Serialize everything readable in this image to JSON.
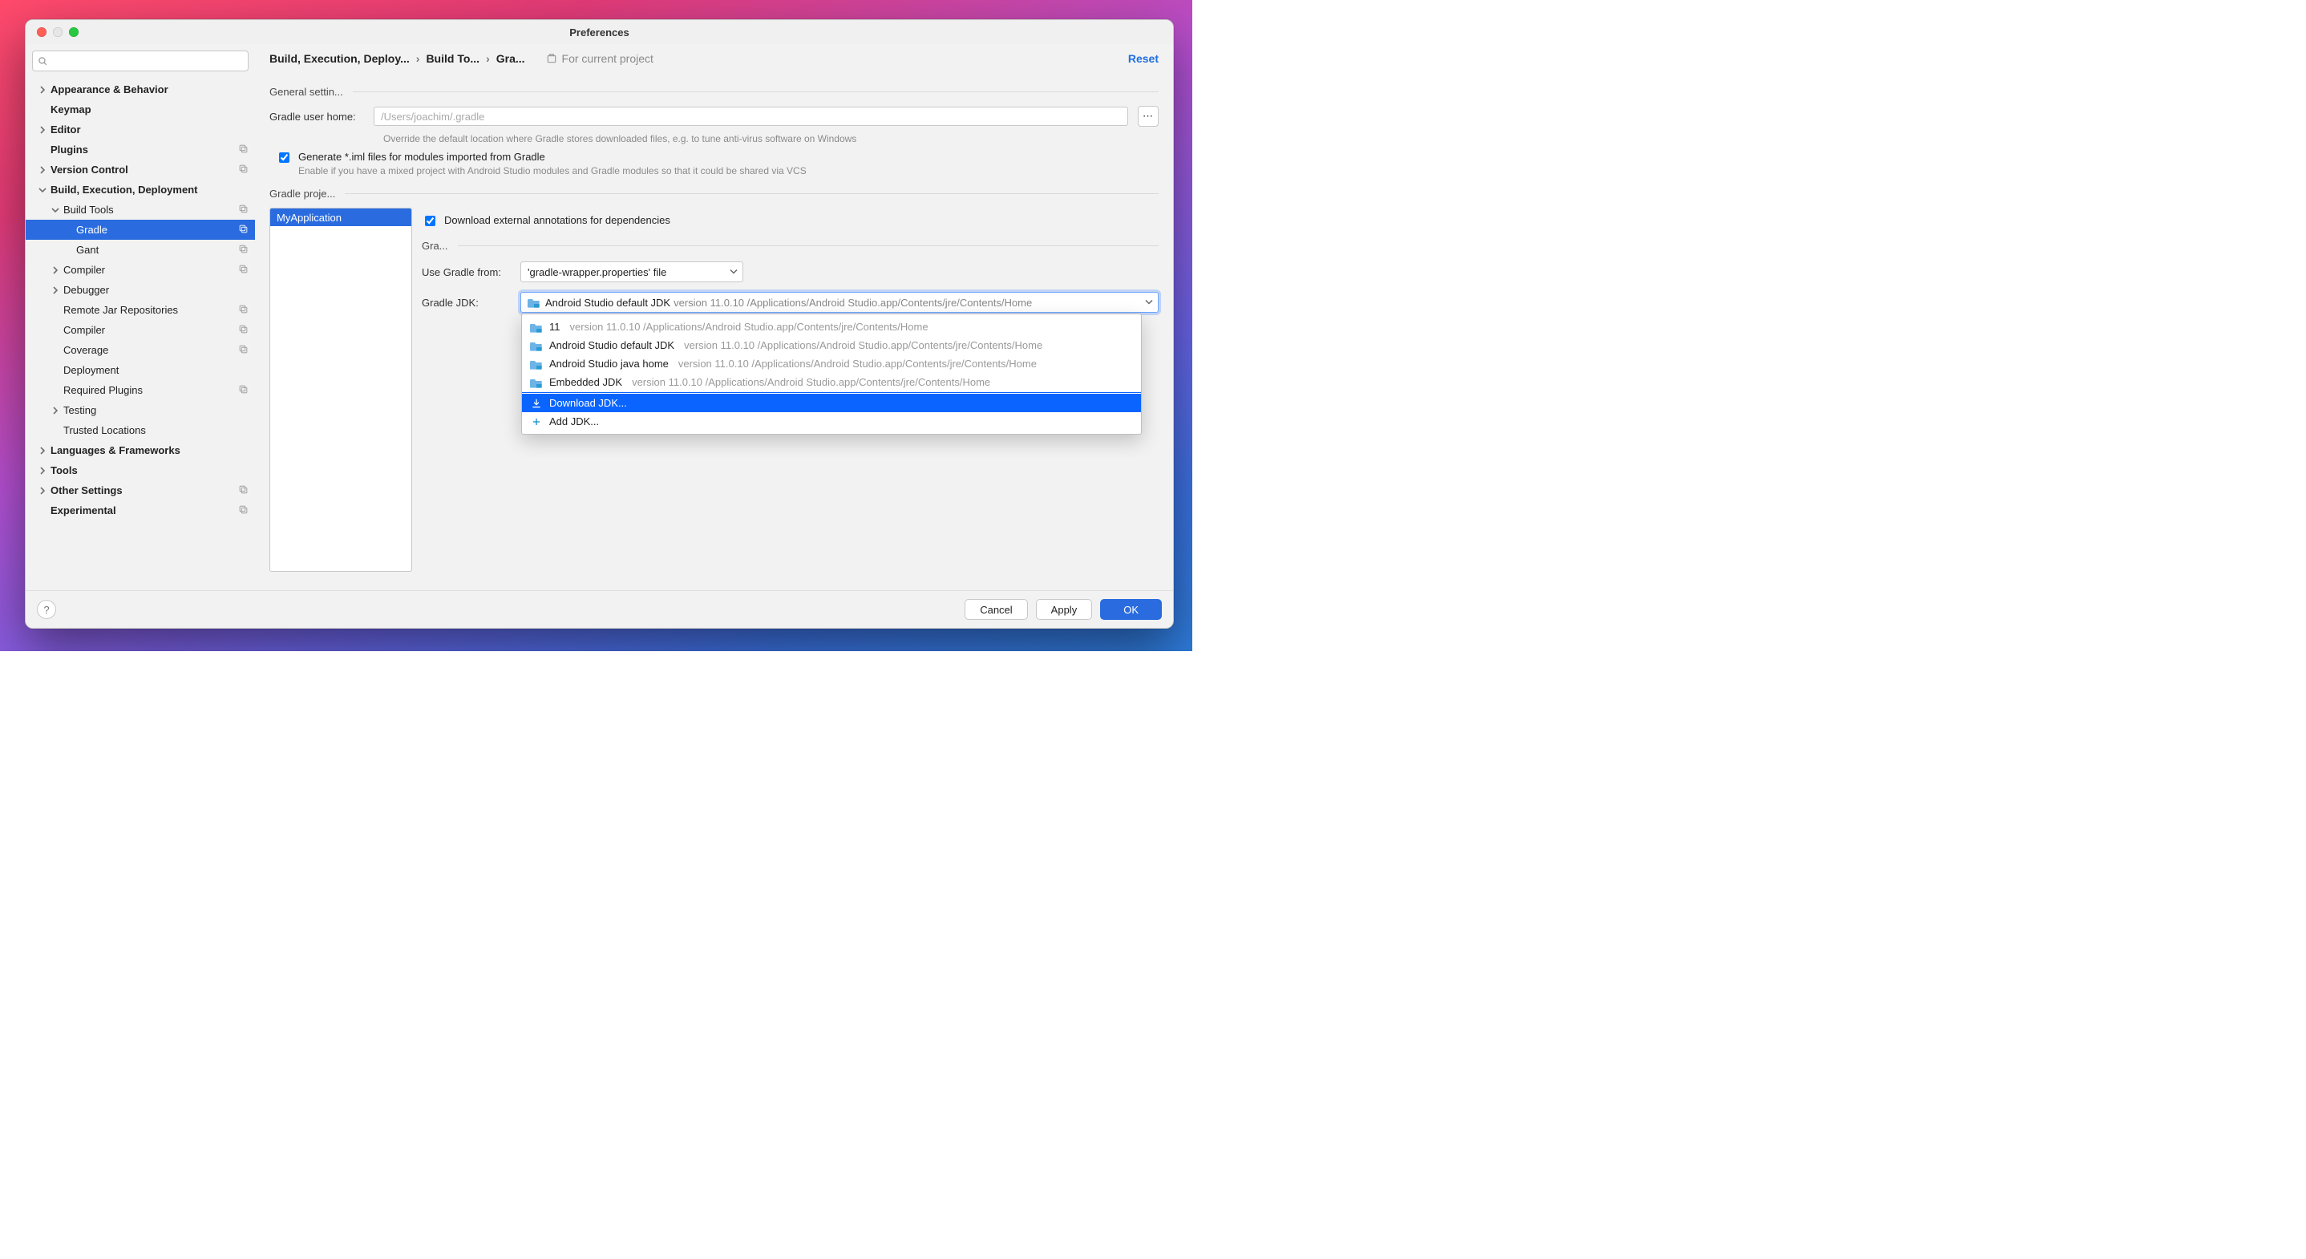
{
  "window": {
    "title": "Preferences"
  },
  "breadcrumb": {
    "c1": "Build, Execution, Deploy...",
    "c2": "Build To...",
    "c3": "Gra...",
    "scope": "For current project",
    "reset": "Reset"
  },
  "sidebar": {
    "items": [
      {
        "label": "Appearance & Behavior",
        "bold": true,
        "chev": "right",
        "indent": 0,
        "copy": false
      },
      {
        "label": "Keymap",
        "bold": true,
        "chev": "none",
        "indent": 0,
        "copy": false
      },
      {
        "label": "Editor",
        "bold": true,
        "chev": "right",
        "indent": 0,
        "copy": false
      },
      {
        "label": "Plugins",
        "bold": true,
        "chev": "none",
        "indent": 0,
        "copy": true
      },
      {
        "label": "Version Control",
        "bold": true,
        "chev": "right",
        "indent": 0,
        "copy": true
      },
      {
        "label": "Build, Execution, Deployment",
        "bold": true,
        "chev": "down",
        "indent": 0,
        "copy": false
      },
      {
        "label": "Build Tools",
        "bold": false,
        "chev": "down",
        "indent": 1,
        "copy": true
      },
      {
        "label": "Gradle",
        "bold": false,
        "chev": "none",
        "indent": 2,
        "copy": true,
        "selected": true
      },
      {
        "label": "Gant",
        "bold": false,
        "chev": "none",
        "indent": 2,
        "copy": true
      },
      {
        "label": "Compiler",
        "bold": false,
        "chev": "right",
        "indent": 1,
        "copy": true
      },
      {
        "label": "Debugger",
        "bold": false,
        "chev": "right",
        "indent": 1,
        "copy": false
      },
      {
        "label": "Remote Jar Repositories",
        "bold": false,
        "chev": "none",
        "indent": 1,
        "copy": true
      },
      {
        "label": "Compiler",
        "bold": false,
        "chev": "none",
        "indent": 1,
        "copy": true
      },
      {
        "label": "Coverage",
        "bold": false,
        "chev": "none",
        "indent": 1,
        "copy": true
      },
      {
        "label": "Deployment",
        "bold": false,
        "chev": "none",
        "indent": 1,
        "copy": false
      },
      {
        "label": "Required Plugins",
        "bold": false,
        "chev": "none",
        "indent": 1,
        "copy": true
      },
      {
        "label": "Testing",
        "bold": false,
        "chev": "right",
        "indent": 1,
        "copy": false
      },
      {
        "label": "Trusted Locations",
        "bold": false,
        "chev": "none",
        "indent": 1,
        "copy": false
      },
      {
        "label": "Languages & Frameworks",
        "bold": true,
        "chev": "right",
        "indent": 0,
        "copy": false
      },
      {
        "label": "Tools",
        "bold": true,
        "chev": "right",
        "indent": 0,
        "copy": false
      },
      {
        "label": "Other Settings",
        "bold": true,
        "chev": "right",
        "indent": 0,
        "copy": true
      },
      {
        "label": "Experimental",
        "bold": true,
        "chev": "none",
        "indent": 0,
        "copy": true
      }
    ]
  },
  "general": {
    "title": "General settin...",
    "userHomeLabel": "Gradle user home:",
    "userHomePlaceholder": "/Users/joachim/.gradle",
    "userHomeHelp": "Override the default location where Gradle stores downloaded files, e.g. to tune anti-virus software on Windows",
    "imlLabel": "Generate *.iml files for modules imported from Gradle",
    "imlDesc": "Enable if you have a mixed project with Android Studio modules and Gradle modules so that it could be shared via VCS"
  },
  "projects": {
    "title": "Gradle proje...",
    "selected": "MyApplication",
    "downloadAnnotations": "Download external annotations for dependencies",
    "gradleSection": "Gra...",
    "useFromLabel": "Use Gradle from:",
    "useFromValue": "'gradle-wrapper.properties' file",
    "jdkLabel": "Gradle JDK:",
    "jdkSelected": "Android Studio default JDK",
    "jdkSelectedVer": "version 11.0.10 /Applications/Android Studio.app/Contents/jre/Contents/Home",
    "dropdown": [
      {
        "name": "11",
        "ver": "version 11.0.10 /Applications/Android Studio.app/Contents/jre/Contents/Home",
        "icon": "folder"
      },
      {
        "name": "Android Studio default JDK",
        "ver": "version 11.0.10 /Applications/Android Studio.app/Contents/jre/Contents/Home",
        "icon": "folder"
      },
      {
        "name": "Android Studio java home",
        "ver": "version 11.0.10 /Applications/Android Studio.app/Contents/jre/Contents/Home",
        "icon": "folder"
      },
      {
        "name": "Embedded JDK",
        "ver": "version 11.0.10 /Applications/Android Studio.app/Contents/jre/Contents/Home",
        "icon": "folder"
      },
      {
        "name": "Download JDK...",
        "ver": "",
        "icon": "download",
        "highlight": true
      },
      {
        "name": "Add JDK...",
        "ver": "",
        "icon": "add"
      }
    ]
  },
  "footer": {
    "cancel": "Cancel",
    "apply": "Apply",
    "ok": "OK"
  }
}
